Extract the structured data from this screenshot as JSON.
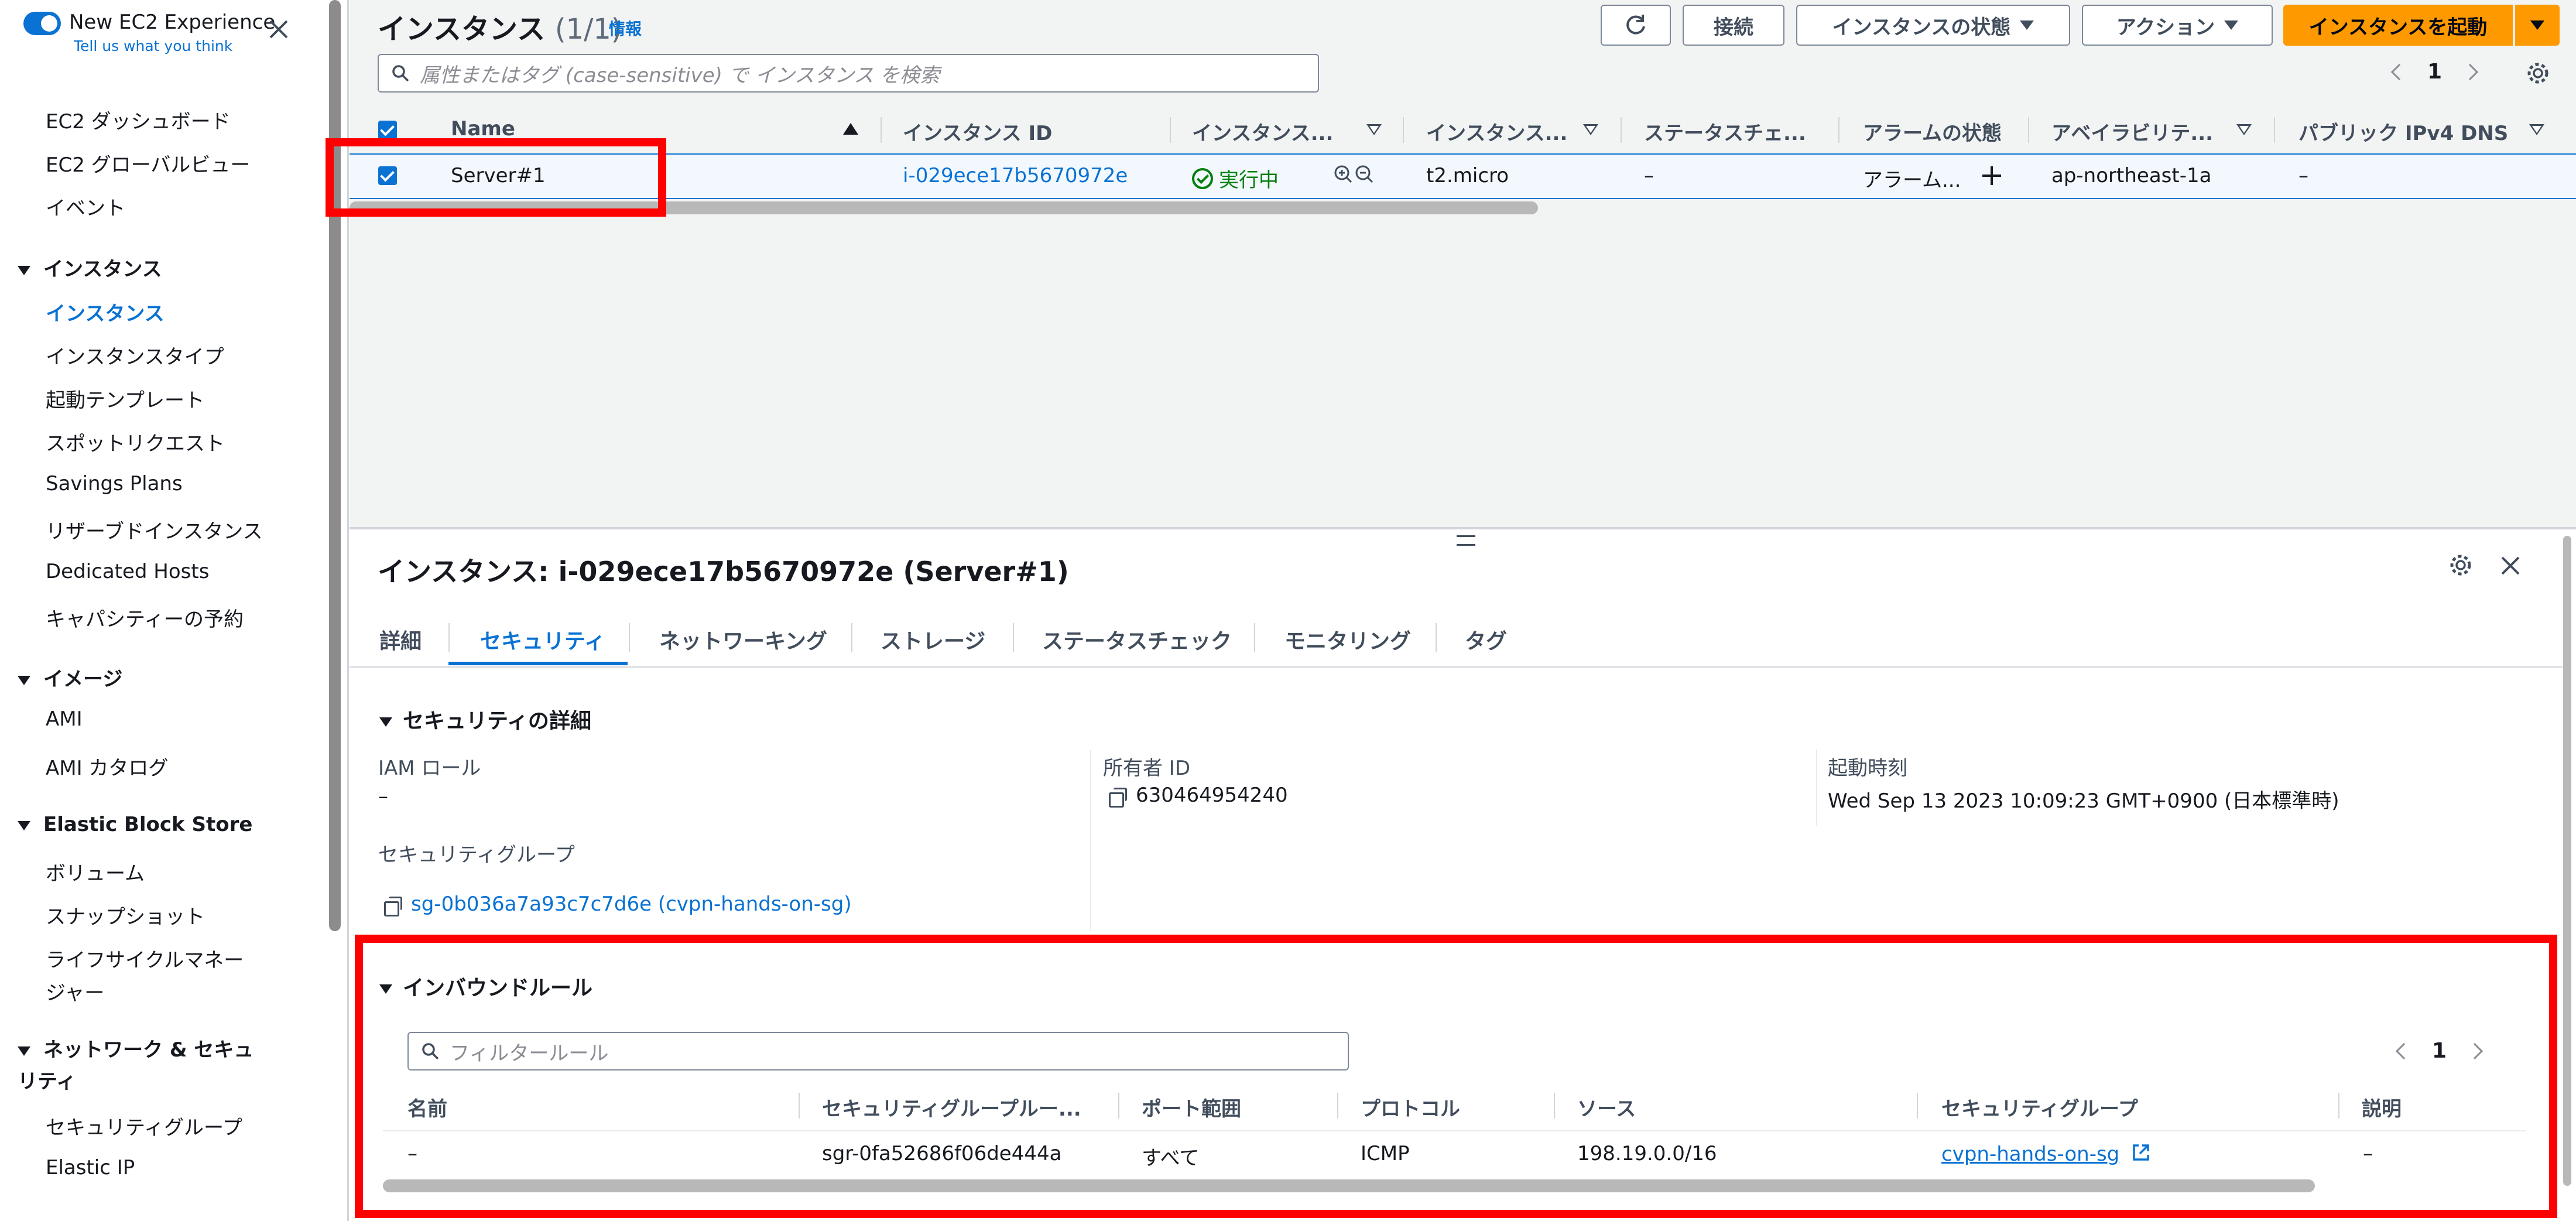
{
  "sidebar": {
    "experience_title": "New EC2 Experience",
    "experience_sub": "Tell us what you think",
    "top_items": [
      "EC2 ダッシュボード",
      "EC2 グローバルビュー",
      "イベント"
    ],
    "groups": [
      {
        "title": "インスタンス",
        "items": [
          "インスタンス",
          "インスタンスタイプ",
          "起動テンプレート",
          "スポットリクエスト",
          "Savings Plans",
          "リザーブドインスタンス",
          "Dedicated Hosts",
          "キャパシティーの予約"
        ]
      },
      {
        "title": "イメージ",
        "items": [
          "AMI",
          "AMI カタログ"
        ]
      },
      {
        "title": "Elastic Block Store",
        "items": [
          "ボリューム",
          "スナップショット",
          "ライフサイクルマネージャー"
        ]
      },
      {
        "title": "ネットワーク & セキュリティ",
        "items": [
          "セキュリティグループ",
          "Elastic IP"
        ]
      }
    ],
    "active_item": "インスタンス"
  },
  "instances": {
    "title": "インスタンス",
    "count": "(1/1)",
    "info": "情報",
    "buttons": {
      "connect": "接続",
      "state": "インスタンスの状態",
      "actions": "アクション",
      "launch": "インスタンスを起動"
    },
    "search_placeholder": "属性またはタグ (case-sensitive) で インスタンス を検索",
    "page": "1",
    "columns": [
      "Name",
      "インスタンス ID",
      "インスタンス...",
      "インスタンス...",
      "ステータスチェ...",
      "アラームの状態",
      "アベイラビリテ...",
      "パブリック IPv4 DNS"
    ],
    "row": {
      "name": "Server#1",
      "id": "i-029ece17b5670972e",
      "state": "実行中",
      "type": "t2.micro",
      "status_check": "–",
      "alarm": "アラーム...",
      "az": "ap-northeast-1a",
      "dns": "–"
    }
  },
  "details": {
    "title": "インスタンス: i-029ece17b5670972e (Server#1)",
    "tabs": [
      "詳細",
      "セキュリティ",
      "ネットワーキング",
      "ストレージ",
      "ステータスチェック",
      "モニタリング",
      "タグ"
    ],
    "active_tab": "セキュリティ",
    "security_section": "セキュリティの詳細",
    "iam_role_label": "IAM ロール",
    "iam_role_value": "–",
    "owner_label": "所有者 ID",
    "owner_value": "630464954240",
    "launch_label": "起動時刻",
    "launch_value": "Wed Sep 13 2023 10:09:23 GMT+0900 (日本標準時)",
    "sg_label": "セキュリティグループ",
    "sg_value": "sg-0b036a7a93c7c7d6e (cvpn-hands-on-sg)",
    "inbound_section": "インバウンドルール",
    "filter_placeholder": "フィルタールール",
    "page": "1",
    "rule_columns": [
      "名前",
      "セキュリティグループルー...",
      "ポート範囲",
      "プロトコル",
      "ソース",
      "セキュリティグループ",
      "説明"
    ],
    "rule_row": {
      "name": "–",
      "rule_id": "sgr-0fa52686f06de444a",
      "port": "すべて",
      "protocol": "ICMP",
      "source": "198.19.0.0/16",
      "sg": "cvpn-hands-on-sg",
      "desc": "–"
    }
  },
  "colors": {
    "accent": "#0972d3",
    "launch": "#ff9900",
    "running": "#037f0c",
    "highlight": "#ff0000"
  }
}
